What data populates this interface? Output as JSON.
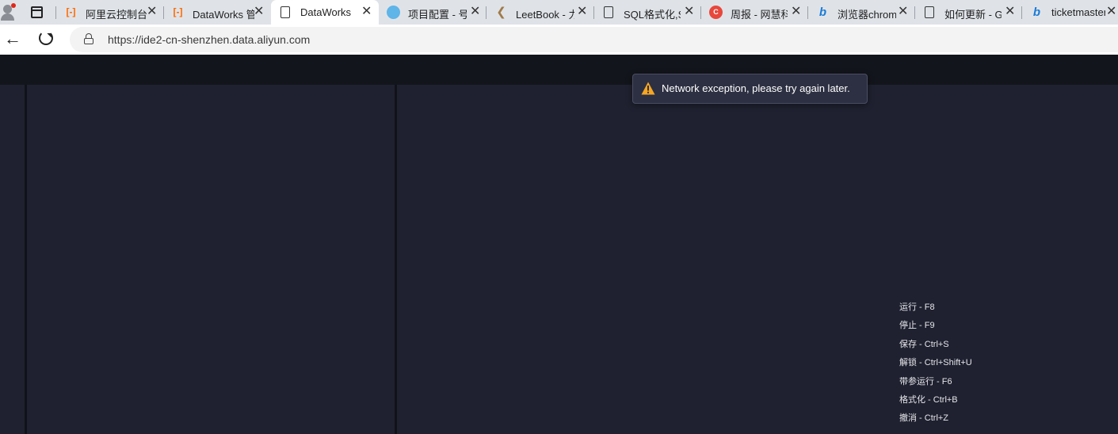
{
  "browser": {
    "tabs": [
      {
        "label": "阿里云控制台",
        "icon": "aliyun-icon",
        "active": false
      },
      {
        "label": "DataWorks 管",
        "icon": "aliyun-icon",
        "active": false
      },
      {
        "label": "DataWorks",
        "icon": "document-icon",
        "active": true
      },
      {
        "label": "项目配置 - 号",
        "icon": "project-icon",
        "active": false
      },
      {
        "label": "LeetBook - 力",
        "icon": "leetcode-icon",
        "active": false
      },
      {
        "label": "SQL格式化,SQ",
        "icon": "document-icon",
        "active": false
      },
      {
        "label": "周报 - 网慧科",
        "icon": "ci-icon",
        "active": false
      },
      {
        "label": "浏览器chrom",
        "icon": "bing-icon",
        "active": false
      },
      {
        "label": "如何更新 - Go",
        "icon": "document-icon",
        "active": false
      },
      {
        "label": "ticketmaster",
        "icon": "bing-icon",
        "active": false
      }
    ],
    "close_glyph": "✕",
    "address": {
      "url": "https://ide2-cn-shenzhen.data.aliyun.com"
    }
  },
  "toast": {
    "message": "Network exception, please try again later.",
    "icon": "warning-icon",
    "color": "#f5a623"
  },
  "shortcuts": [
    "运行 - F8",
    "停止 - F9",
    "保存 - Ctrl+S",
    "解锁 - Ctrl+Shift+U",
    "带参运行 - F6",
    "格式化 - Ctrl+B",
    "撤消 - Ctrl+Z"
  ]
}
